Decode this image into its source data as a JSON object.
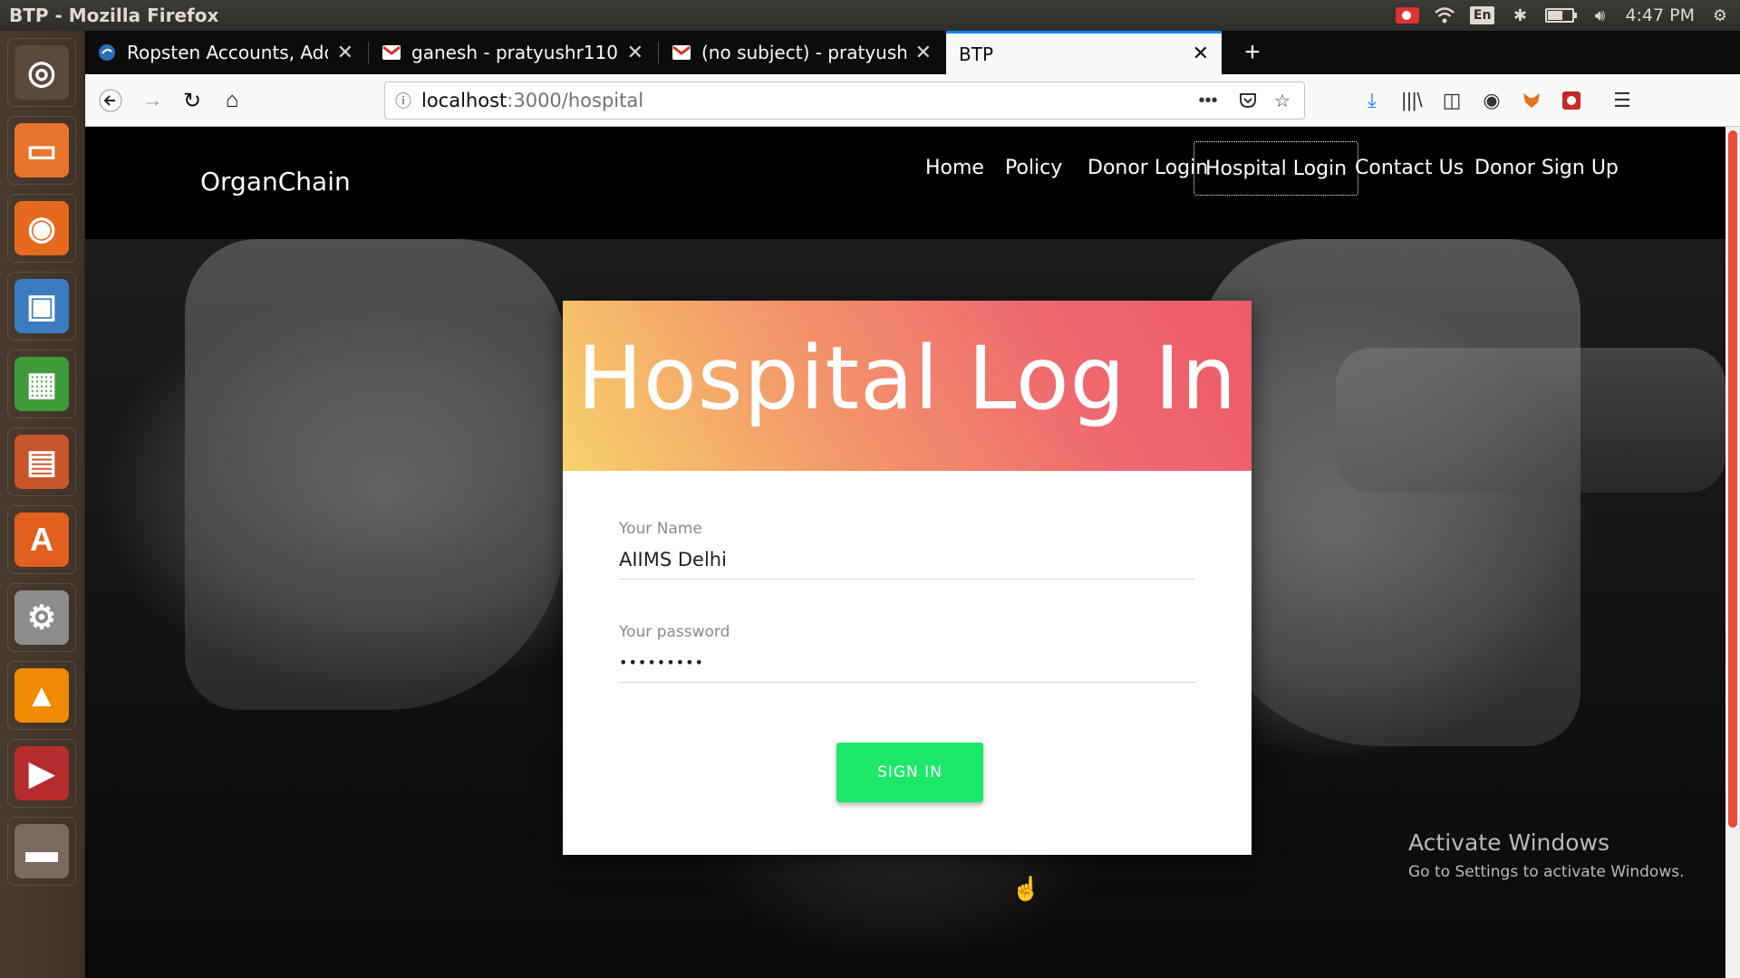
{
  "window": {
    "title": "BTP - Mozilla Firefox"
  },
  "tray": {
    "language": "En",
    "battery_level": 0.6,
    "time": "4:47 PM"
  },
  "launcher": {
    "items": [
      {
        "name": "ubuntu-dash",
        "color": "#5a4a3c"
      },
      {
        "name": "files",
        "color": "#e8742c"
      },
      {
        "name": "firefox",
        "color": "#e56a1e"
      },
      {
        "name": "image-viewer",
        "color": "#3b7bbf"
      },
      {
        "name": "libreoffice-calc",
        "color": "#3f9a3a"
      },
      {
        "name": "libreoffice-impress",
        "color": "#c9552b"
      },
      {
        "name": "software-center",
        "color": "#e2601f"
      },
      {
        "name": "system-settings",
        "color": "#8c8c8c"
      },
      {
        "name": "vlc",
        "color": "#f08a00"
      },
      {
        "name": "pdf-reader",
        "color": "#b62c2c"
      },
      {
        "name": "scanner",
        "color": "#7a6a60"
      }
    ]
  },
  "tabs": [
    {
      "label": "Ropsten Accounts, Addr",
      "favicon": "#2d6fb7"
    },
    {
      "label": "ganesh - pratyushr1102",
      "favicon": "#d93025"
    },
    {
      "label": "(no subject) - pratyushr1",
      "favicon": "#d93025"
    },
    {
      "label": "BTP",
      "favicon": ""
    }
  ],
  "urlbar": {
    "host": "localhost",
    "path": ":3000/hospital"
  },
  "site": {
    "brand": "OrganChain",
    "nav": [
      "Home",
      "Policy",
      "Donor Login",
      "Hospital Login",
      "Contact Us",
      "Donor Sign Up"
    ],
    "active_nav": "Hospital Login"
  },
  "form": {
    "title": "Hospital Log In",
    "name_label": "Your Name",
    "name_value": "AIIMS Delhi",
    "password_label": "Your password",
    "password_value": "•••••••••",
    "submit_label": "SIGN IN"
  },
  "watermark": {
    "title": "Activate Windows",
    "subtitle": "Go to Settings to activate Windows."
  },
  "colors": {
    "accent_tab": "#0a84ff",
    "button": "#1de86a",
    "scrollbar": "#e74c3c"
  }
}
